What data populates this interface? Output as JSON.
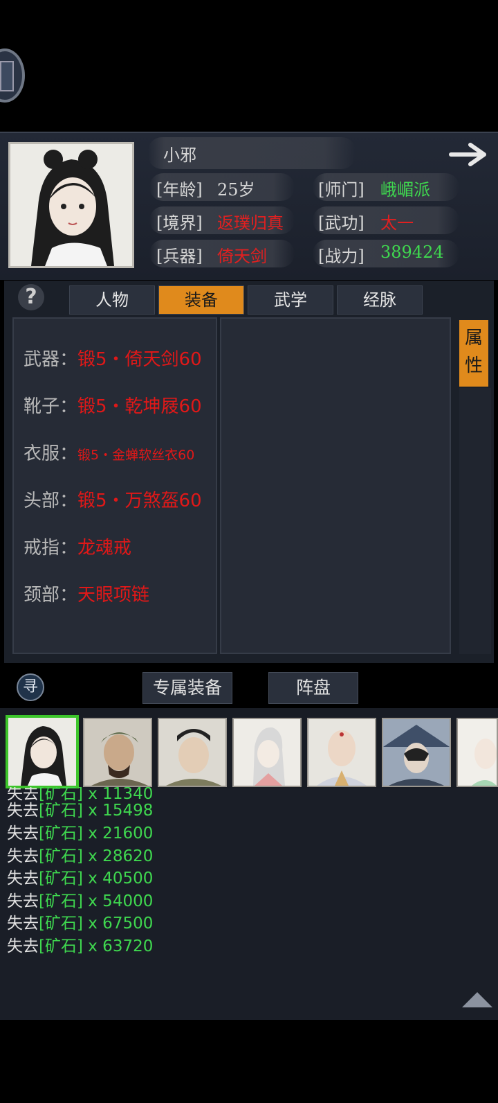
{
  "profile": {
    "name": "小邪",
    "age_label": "[年龄]",
    "age_value": "25岁",
    "sect_label": "[师门]",
    "sect_value": "峨嵋派",
    "realm_label": "[境界]",
    "realm_value": "返璞归真",
    "skill_label": "[武功]",
    "skill_value": "太一",
    "weapon_label": "[兵器]",
    "weapon_value": "倚天剑",
    "power_label": "[战力]",
    "power_value": "389424"
  },
  "tabs": [
    {
      "label": "人物",
      "active": false
    },
    {
      "label": "装备",
      "active": true
    },
    {
      "label": "武学",
      "active": false
    },
    {
      "label": "经脉",
      "active": false
    }
  ],
  "help_glyph": "?",
  "attr_tab": {
    "line1": "属",
    "line2": "性"
  },
  "equipment": [
    {
      "label": "武器：",
      "value": "锻5・倚天剑60"
    },
    {
      "label": "靴子：",
      "value": "锻5・乾坤屐60"
    },
    {
      "label": "衣服：",
      "value": "锻5・金蝉软丝衣60"
    },
    {
      "label": "头部：",
      "value": "锻5・万煞盔60"
    },
    {
      "label": "戒指：",
      "value": "龙魂戒"
    },
    {
      "label": "颈部：",
      "value": "天眼项链"
    }
  ],
  "search_glyph": "寻",
  "sub_buttons": {
    "exclusive": "专属装备",
    "formation": "阵盘"
  },
  "log": [
    {
      "pre": "失去",
      "item": "[矿石]",
      "qty": " x 11340"
    },
    {
      "pre": "失去",
      "item": "[矿石]",
      "qty": " x 15498"
    },
    {
      "pre": "失去",
      "item": "[矿石]",
      "qty": " x 21600"
    },
    {
      "pre": "失去",
      "item": "[矿石]",
      "qty": " x 28620"
    },
    {
      "pre": "失去",
      "item": "[矿石]",
      "qty": " x 40500"
    },
    {
      "pre": "失去",
      "item": "[矿石]",
      "qty": " x 54000"
    },
    {
      "pre": "失去",
      "item": "[矿石]",
      "qty": " x 67500"
    },
    {
      "pre": "失去",
      "item": "[矿石]",
      "qty": " x 63720"
    }
  ],
  "colors": {
    "accent": "#e08a1c",
    "red": "#e02020",
    "green": "#3fd84f",
    "selected_border": "#3dc52b"
  }
}
